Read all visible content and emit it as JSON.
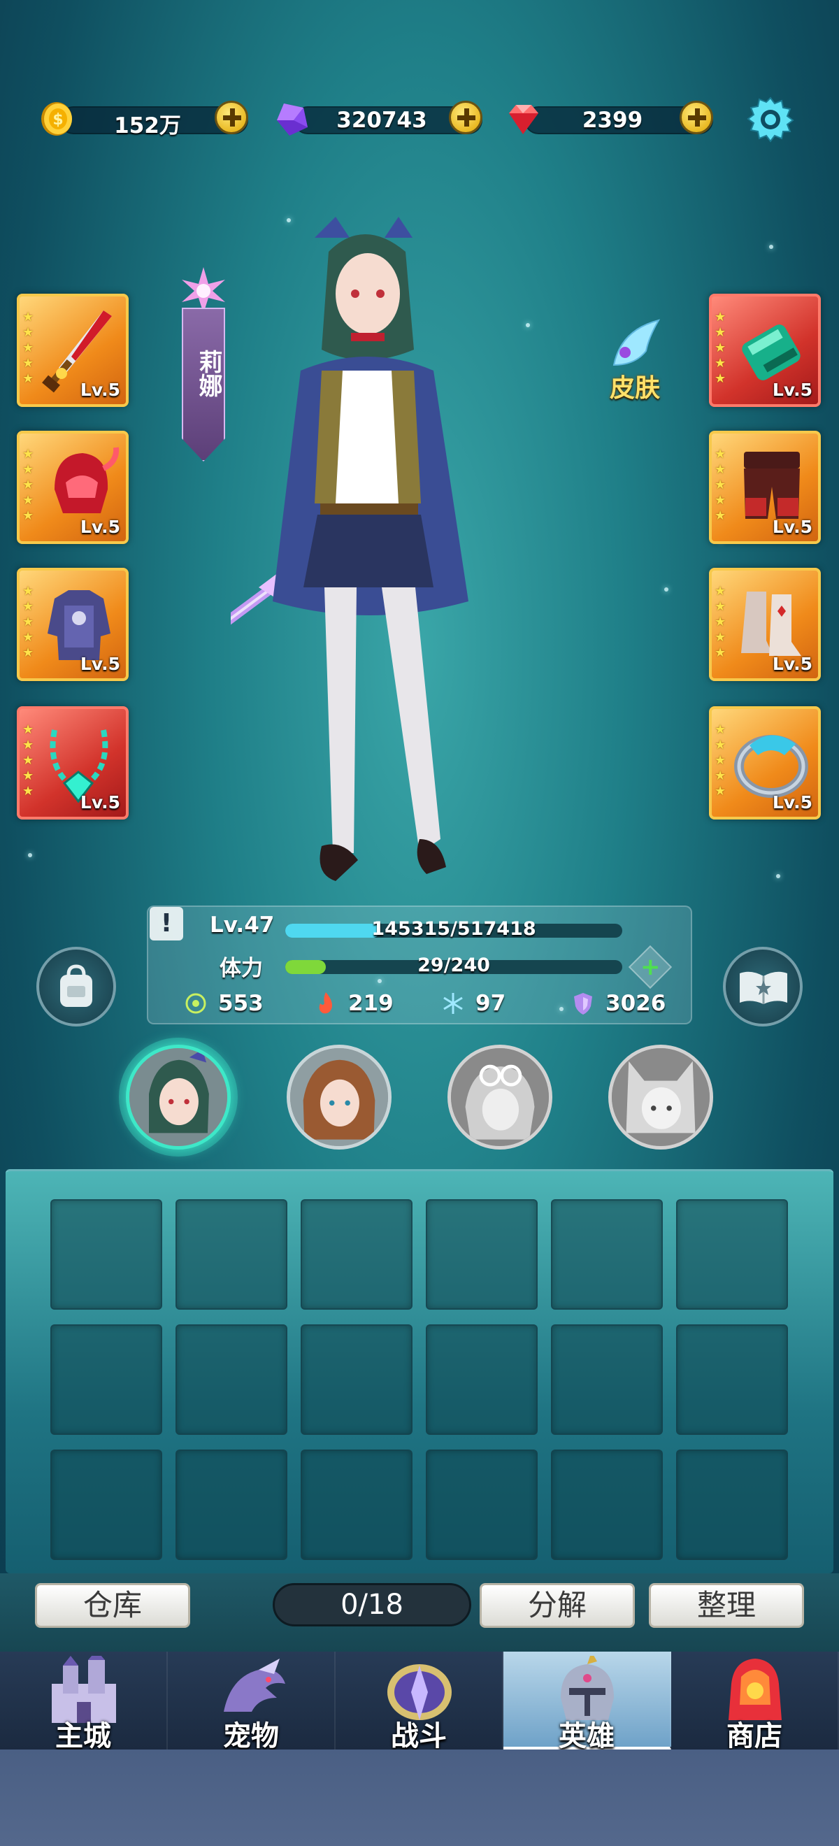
{
  "currency": {
    "gold": "152万",
    "crystal": "320743",
    "gem": "2399"
  },
  "hero": {
    "name": "莉娜",
    "skin_label": "皮肤",
    "level": "Lv.47",
    "exp": "145315/517418",
    "exp_fraction": 0.28,
    "stamina_label": "体力",
    "stamina": "29/240",
    "stamina_fraction": 0.12,
    "attrs": {
      "attack": "553",
      "fire": "219",
      "ice": "97",
      "defense": "3026"
    }
  },
  "equipment": {
    "left": [
      {
        "icon": "sword-icon",
        "level": "Lv.5",
        "rarity": "gold"
      },
      {
        "icon": "helmet-icon",
        "level": "Lv.5",
        "rarity": "gold"
      },
      {
        "icon": "armor-icon",
        "level": "Lv.5",
        "rarity": "gold"
      },
      {
        "icon": "necklace-icon",
        "level": "Lv.5",
        "rarity": "red"
      }
    ],
    "right": [
      {
        "icon": "bracer-icon",
        "level": "Lv.5",
        "rarity": "red"
      },
      {
        "icon": "pants-icon",
        "level": "Lv.5",
        "rarity": "gold"
      },
      {
        "icon": "boots-icon",
        "level": "Lv.5",
        "rarity": "gold"
      },
      {
        "icon": "ring-icon",
        "level": "Lv.5",
        "rarity": "gold"
      }
    ]
  },
  "inventory": {
    "count": "0/18",
    "warehouse_label": "仓库",
    "decompose_label": "分解",
    "sort_label": "整理"
  },
  "nav": {
    "items": [
      {
        "label": "主城",
        "icon": "castle-icon"
      },
      {
        "label": "宠物",
        "icon": "dragon-icon"
      },
      {
        "label": "战斗",
        "icon": "battle-icon"
      },
      {
        "label": "英雄",
        "icon": "knight-helmet-icon"
      },
      {
        "label": "商店",
        "icon": "shop-icon"
      }
    ],
    "active": "英雄"
  },
  "colors": {
    "exp_bar": "#4fd8f0",
    "stamina_bar": "#7fd83a",
    "active_avatar": "#3ee8c8"
  }
}
